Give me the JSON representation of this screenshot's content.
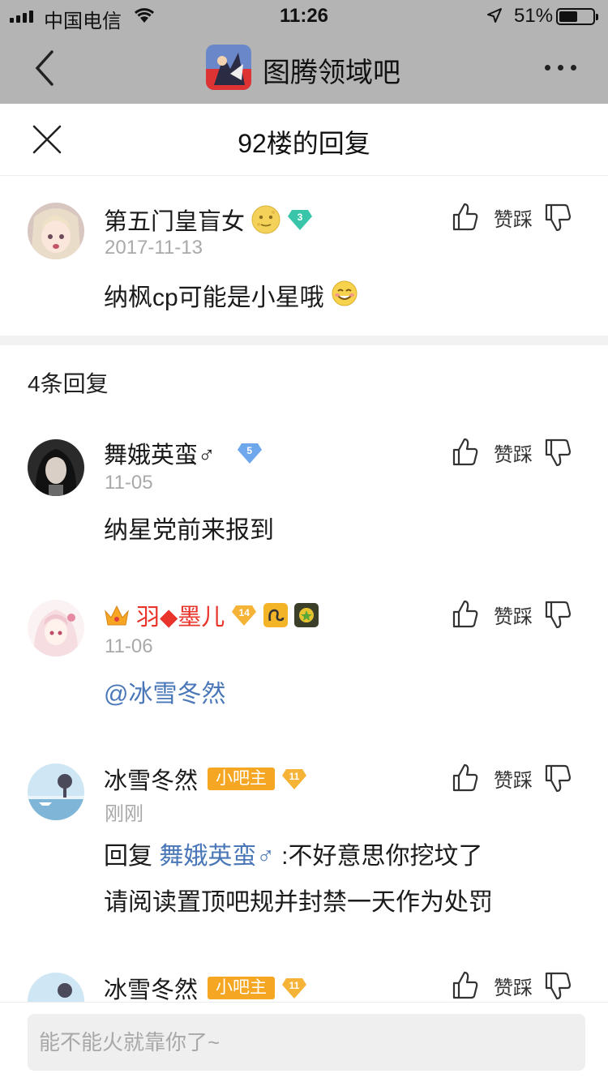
{
  "status_bar": {
    "carrier": "中国电信",
    "time": "11:26",
    "battery": "51%"
  },
  "nav": {
    "title": "图腾领域吧",
    "back_icon": "chevron-left-icon",
    "more_icon": "more-dots-icon"
  },
  "panel": {
    "title": "92楼的回复",
    "close_icon": "close-icon"
  },
  "main_post": {
    "username": "第五门皇盲女",
    "level": "3",
    "date": "2017-11-13",
    "content": "纳枫cp可能是小星哦",
    "emoji": "😊",
    "vote_label": "赞踩"
  },
  "reply_count": "4条回复",
  "replies": [
    {
      "username": "舞娥英蛮♂",
      "level": "5",
      "date": "11-05",
      "content": "纳星党前来报到",
      "vote_label": "赞踩"
    },
    {
      "username": "羽◆墨儿",
      "level": "14",
      "date": "11-06",
      "mention": "@冰雪冬然",
      "vote_label": "赞踩"
    },
    {
      "username": "冰雪冬然",
      "badge": "小吧主",
      "level": "11",
      "date": "刚刚",
      "reply_prefix": "回复 ",
      "reply_target": "舞娥英蛮♂",
      "line1_rest": " :不好意思你挖坟了",
      "line2": "请阅读置顶吧规并封禁一天作为处罚",
      "vote_label": "赞踩"
    },
    {
      "username": "冰雪冬然",
      "badge": "小吧主",
      "level": "11",
      "vote_label": "赞踩"
    }
  ],
  "input": {
    "placeholder": "能不能火就靠你了~"
  },
  "colors": {
    "owner_badge": "#f5a623",
    "mention": "#4a77b8",
    "vip_name": "#e8342a",
    "topbar_dim": "#b4b4b4"
  }
}
